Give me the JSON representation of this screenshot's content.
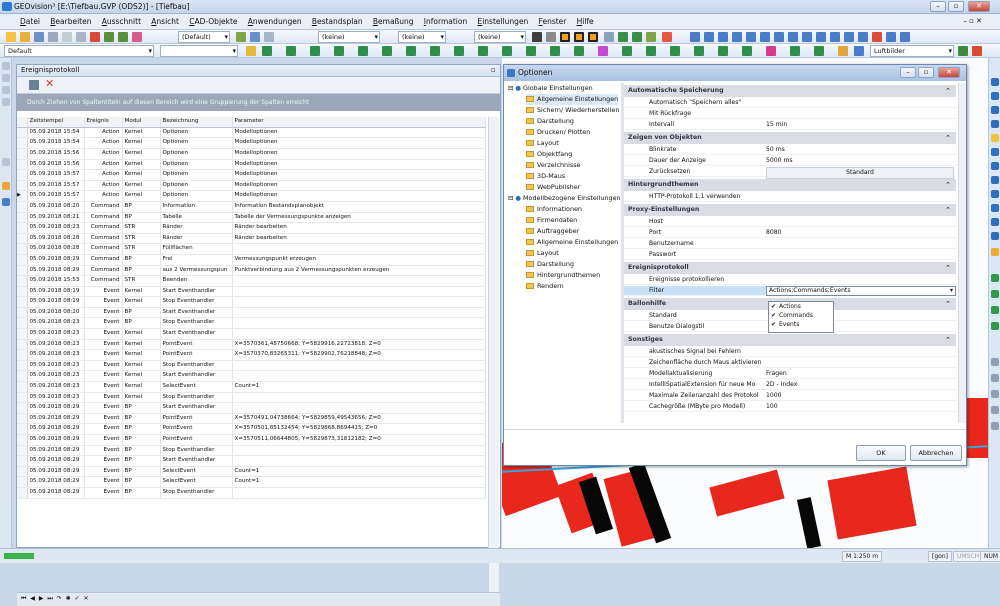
{
  "app": {
    "title": "GEOvision³ [E:\\Tiefbau.GVP (ODS2)] - [Tiefbau]"
  },
  "menu": [
    "Datei",
    "Bearbeiten",
    "Ausschnitt",
    "Ansicht",
    "CAD-Objekte",
    "Anwendungen",
    "Bestandsplan",
    "Bemaßung",
    "Information",
    "Einstellungen",
    "Fenster",
    "Hilfe"
  ],
  "toolbar": {
    "style_combo": "(Default)",
    "combo1": "(keine)",
    "combo2": "(keine)",
    "combo3": "(keine)",
    "layer": "Default",
    "luftbilder": "Luftbilder"
  },
  "eventlog": {
    "title": "Ereignisprotokoll",
    "group_hint": "Durch Ziehen von Spaltentiteln auf diesen Bereich wird eine Gruppierung der Spalten erreicht",
    "columns": [
      "Zeitstempel",
      "Ereignis",
      "Modul",
      "Bezeichnung",
      "Parameter"
    ],
    "rows": [
      [
        "05.09.2018 15:54",
        "Action",
        "Kernel",
        "Optionen",
        "Modelloptionen"
      ],
      [
        "05.09.2018 15:54",
        "Action",
        "Kernel",
        "Optionen",
        "Modelloptionen"
      ],
      [
        "05.09.2018 15:56",
        "Action",
        "Kernel",
        "Optionen",
        "Modelloptionen"
      ],
      [
        "05.09.2018 15:56",
        "Action",
        "Kernel",
        "Optionen",
        "Modelloptionen"
      ],
      [
        "05.09.2018 15:57",
        "Action",
        "Kernel",
        "Optionen",
        "Modelloptionen"
      ],
      [
        "05.09.2018 15:57",
        "Action",
        "Kernel",
        "Optionen",
        "Modelloptionen"
      ],
      [
        "05.09.2018 15:57",
        "Action",
        "Kernel",
        "Optionen",
        "Modelloptionen"
      ],
      [
        "05.09.2018 08:20",
        "Command",
        "BP",
        "Information",
        "Information Bestandsplanobjekt"
      ],
      [
        "05.09.2018 08:21",
        "Command",
        "BP",
        "Tabelle",
        "Tabelle der Vermessungspunkte anzeigen"
      ],
      [
        "05.09.2018 08:23",
        "Command",
        "STR",
        "Ränder",
        "Ränder bearbeiten"
      ],
      [
        "05.09.2018 08:28",
        "Command",
        "STR",
        "Ränder",
        "Ränder bearbeiten"
      ],
      [
        "05.09.2018 08:28",
        "Command",
        "STR",
        "Füllflächen",
        ""
      ],
      [
        "05.09.2018 08:29",
        "Command",
        "BP",
        "Frei",
        "Vermessungspunkt erzeugen"
      ],
      [
        "05.09.2018 08:29",
        "Command",
        "BP",
        "aus 2 Vermessungspun",
        "Punktverbindung aus 2 Vermessungspunkten erzeugen"
      ],
      [
        "05.09.2018 15:53",
        "Command",
        "STR",
        "Beenden",
        ""
      ],
      [
        "05.09.2018 08:19",
        "Event",
        "Kernel",
        "Start Eventhandler",
        ""
      ],
      [
        "05.09.2018 08:19",
        "Event",
        "Kernel",
        "Stop Eventhandler",
        ""
      ],
      [
        "05.09.2018 08:20",
        "Event",
        "BP",
        "Start Eventhandler",
        ""
      ],
      [
        "05.09.2018 08:23",
        "Event",
        "BP",
        "Stop Eventhandler",
        ""
      ],
      [
        "05.09.2018 08:23",
        "Event",
        "Kernel",
        "Start Eventhandler",
        ""
      ],
      [
        "05.09.2018 08:23",
        "Event",
        "Kernel",
        "PointEvent",
        "X=3570361,48750668; Y=5829916,22723818; Z=0"
      ],
      [
        "05.09.2018 08:23",
        "Event",
        "Kernel",
        "PointEvent",
        "X=3570370,83265311; Y=5829902,76218848; Z=0"
      ],
      [
        "05.09.2018 08:23",
        "Event",
        "Kernel",
        "Stop Eventhandler",
        ""
      ],
      [
        "05.09.2018 08:23",
        "Event",
        "Kernel",
        "Start Eventhandler",
        ""
      ],
      [
        "05.09.2018 08:23",
        "Event",
        "Kernel",
        "SelectEvent",
        "Count=1"
      ],
      [
        "05.09.2018 08:23",
        "Event",
        "Kernel",
        "Stop Eventhandler",
        ""
      ],
      [
        "05.09.2018 08:29",
        "Event",
        "BP",
        "Start Eventhandler",
        ""
      ],
      [
        "05.09.2018 08:29",
        "Event",
        "BP",
        "PointEvent",
        "X=3570491,04738664; Y=5829859,49543656; Z=0"
      ],
      [
        "05.09.2018 08:29",
        "Event",
        "BP",
        "PointEvent",
        "X=3570501,85132454; Y=5829868,8694415; Z=0"
      ],
      [
        "05.09.2018 08:29",
        "Event",
        "BP",
        "PointEvent",
        "X=3570511,06644805; Y=5829873,31812182; Z=0"
      ],
      [
        "05.09.2018 08:29",
        "Event",
        "BP",
        "Stop Eventhandler",
        ""
      ],
      [
        "05.09.2018 08:29",
        "Event",
        "BP",
        "Start Eventhandler",
        ""
      ],
      [
        "05.09.2018 08:29",
        "Event",
        "BP",
        "SelectEvent",
        "Count=1"
      ],
      [
        "05.09.2018 08:29",
        "Event",
        "BP",
        "SelectEvent",
        "Count=1"
      ],
      [
        "05.09.2018 08:29",
        "Event",
        "BP",
        "Stop Eventhandler",
        ""
      ]
    ]
  },
  "options": {
    "title": "Optionen",
    "tree_global": "Globale Einstellungen",
    "tree_global_items": [
      "Allgemeine Einstellungen",
      "Sichern/ Wiederherstellen",
      "Darstellung",
      "Drucken/ Plotten",
      "Layout",
      "Objektfang",
      "Verzeichnisse",
      "3D-Maus",
      "WebPublisher"
    ],
    "tree_model": "Modellbezogene Einstellungen",
    "tree_model_items": [
      "Informationen",
      "Firmendaten",
      "Auftraggeber",
      "Allgemeine Einstellungen",
      "Layout",
      "Darstellung",
      "Hintergrundthemen",
      "Rendern"
    ],
    "sections": {
      "auto_save": "Automatische Speicherung",
      "zoom": "Zeigen von Objekten",
      "background": "Hintergrundthemen",
      "proxy": "Proxy-Einstellungen",
      "eventlog": "Ereignisprotokoll",
      "balloon": "Ballonhilfe",
      "misc": "Sonstiges"
    },
    "props": {
      "auto_save_all": "Automatisch \"Speichern alles\"",
      "with_query": "Mit Rückfrage",
      "interval": "Intervall",
      "interval_val": "15 min",
      "blink": "Blinkrate",
      "blink_val": "50 ms",
      "duration": "Dauer der Anzeige",
      "duration_val": "5000 ms",
      "reset": "Zurücksetzen",
      "reset_val": "Standard",
      "http11": "HTTP-Protokoll 1.1 verwenden",
      "host": "Host",
      "port": "Port",
      "port_val": "8080",
      "user": "Benutzername",
      "password": "Passwort",
      "log_events": "Ereignisse protokollieren",
      "filter": "Filter",
      "filter_val": "Actions;Commands;Events",
      "standard": "Standard",
      "dialog_style": "Benutze Dialogstil",
      "sound": "akustisches Signal bei Fehlern",
      "draw_area": "Zeichenfläche durch Maus aktivieren",
      "model_update": "Modellaktualisierung",
      "model_update_val": "Fragen",
      "intelli": "IntelliSpatialExtension für neue Mo",
      "intelli_val": "2D - Index",
      "max_lines": "Maximale Zeilenanzahl des Protokol",
      "max_lines_val": "1000",
      "cache": "Cachegröße (MByte pro Modell)",
      "cache_val": "100"
    },
    "filter_options": [
      "Actions",
      "Commands",
      "Events"
    ],
    "ok": "OK",
    "cancel": "Abbrechen"
  },
  "status": {
    "scale": "M 1:250",
    "unit": "m",
    "angle": "[gon]",
    "caps": "UMSCH",
    "num": "NUM"
  }
}
